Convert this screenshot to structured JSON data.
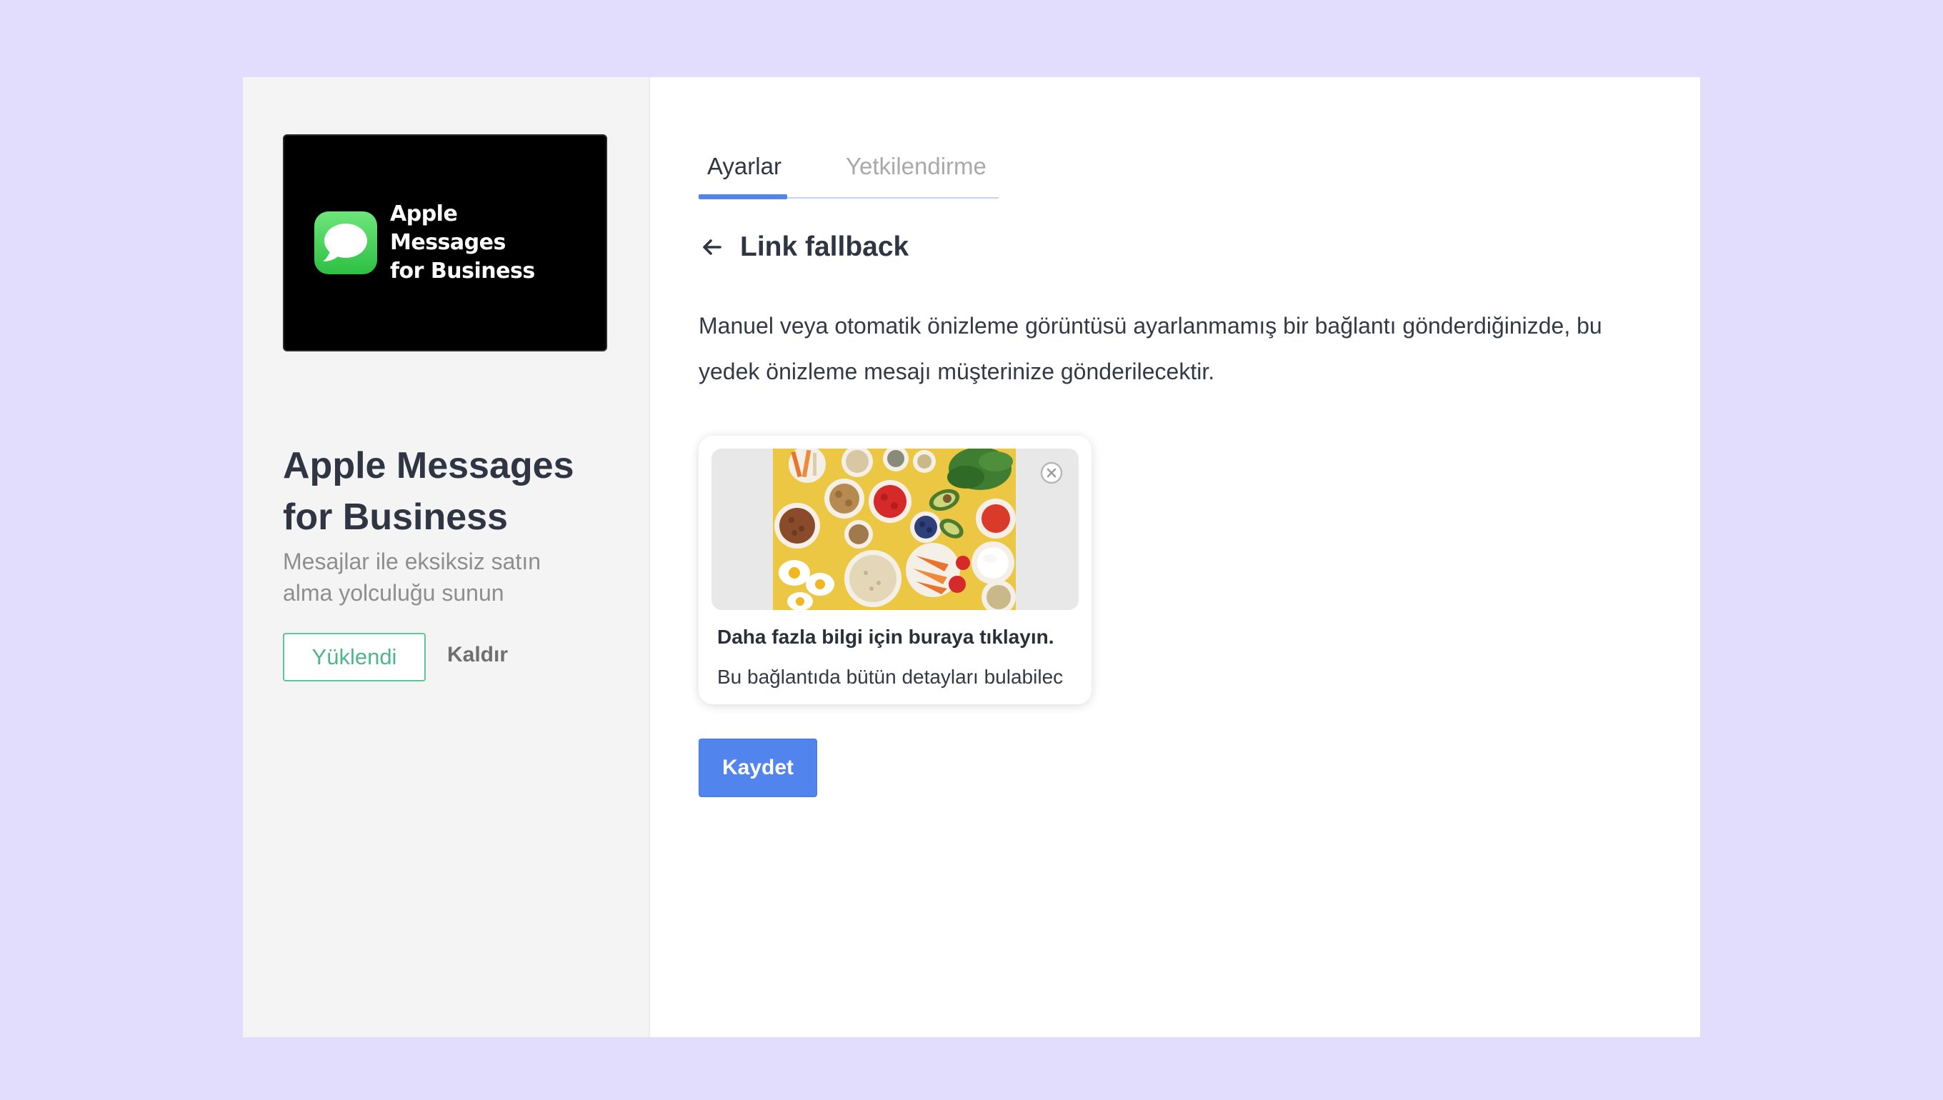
{
  "sidebar": {
    "logo": {
      "icon": "messages-bubble-icon",
      "line1": "Apple Messages",
      "line2": "for Business"
    },
    "title": "Apple Messages for Business",
    "subtitle": "Mesajlar ile eksiksiz satın alma yolculuğu sunun",
    "installed_label": "Yüklendi",
    "remove_label": "Kaldır"
  },
  "tabs": [
    {
      "label": "Ayarlar",
      "active": true
    },
    {
      "label": "Yetkilendirme",
      "active": false
    }
  ],
  "section": {
    "back_icon": "arrow-left-icon",
    "title": "Link fallback",
    "description": "Manuel veya otomatik önizleme görüntüsü ayarlanmamış bir bağlantı gönderdiğinizde, bu yedek önizleme mesajı müşterinize gönderilecektir."
  },
  "preview": {
    "image_icon": "food-bowls-image",
    "close_icon": "close-circle-icon",
    "headline": "Daha fazla bilgi için buraya tıklayın.",
    "body": "Bu bağlantıda bütün detayları bulabilec"
  },
  "actions": {
    "save_label": "Kaydet"
  },
  "colors": {
    "background": "#e2ddfd",
    "accent": "#5284ee",
    "installed": "#4fb68a",
    "sidebar": "#f4f4f4"
  }
}
